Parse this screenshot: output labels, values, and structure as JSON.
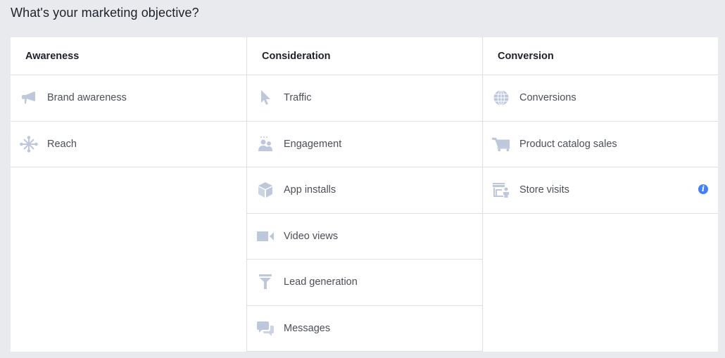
{
  "page": {
    "title": "What's your marketing objective?"
  },
  "colors": {
    "icon": "#bec8dc",
    "info": "#4080ff",
    "border": "#dddfe2",
    "background": "#e9eaed"
  },
  "columns": [
    {
      "header": "Awareness",
      "items": [
        {
          "label": "Brand awareness",
          "icon": "megaphone-icon"
        },
        {
          "label": "Reach",
          "icon": "network-icon"
        }
      ]
    },
    {
      "header": "Consideration",
      "items": [
        {
          "label": "Traffic",
          "icon": "cursor-icon"
        },
        {
          "label": "Engagement",
          "icon": "people-icon"
        },
        {
          "label": "App installs",
          "icon": "box-icon"
        },
        {
          "label": "Video views",
          "icon": "video-camera-icon"
        },
        {
          "label": "Lead generation",
          "icon": "funnel-icon"
        },
        {
          "label": "Messages",
          "icon": "chat-bubbles-icon"
        }
      ]
    },
    {
      "header": "Conversion",
      "items": [
        {
          "label": "Conversions",
          "icon": "globe-icon"
        },
        {
          "label": "Product catalog sales",
          "icon": "cart-icon"
        },
        {
          "label": "Store visits",
          "icon": "store-person-icon",
          "info_icon": "i"
        }
      ]
    }
  ]
}
